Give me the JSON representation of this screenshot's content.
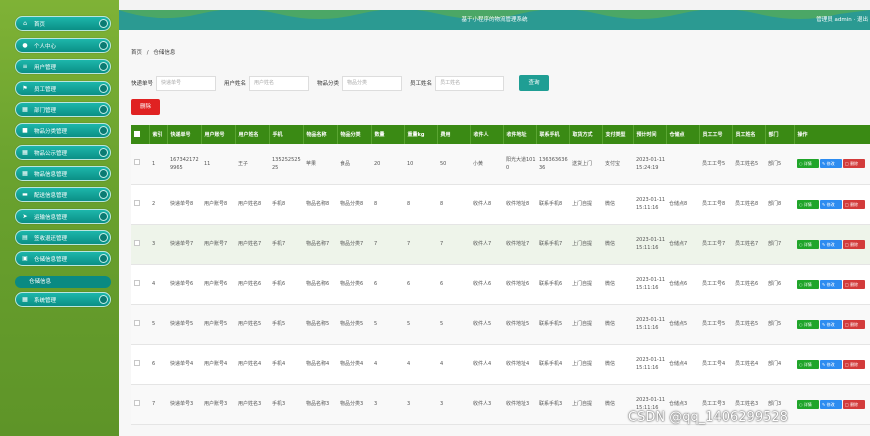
{
  "header": {
    "title": "基于小程序的物流管理系统",
    "user": "管理员 admin · 退出"
  },
  "sidebar": {
    "items": [
      {
        "label": "首页",
        "icon": "home-icon"
      },
      {
        "label": "个人中心",
        "icon": "user-icon"
      },
      {
        "label": "用户管理",
        "icon": "list-icon"
      },
      {
        "label": "员工管理",
        "icon": "flag-icon"
      },
      {
        "label": "部门管理",
        "icon": "grid-icon"
      },
      {
        "label": "物品分类管理",
        "icon": "box-icon"
      },
      {
        "label": "物品公示管理",
        "icon": "grid-icon"
      },
      {
        "label": "物品信息管理",
        "icon": "grid-icon"
      },
      {
        "label": "配送信息管理",
        "icon": "truck-icon"
      },
      {
        "label": "运输信息管理",
        "icon": "send-icon"
      },
      {
        "label": "签收退还管理",
        "icon": "doc-icon"
      },
      {
        "label": "仓储信息管理",
        "icon": "warehouse-icon"
      }
    ],
    "sub_item": "仓储信息",
    "last_item": {
      "label": "系统管理",
      "icon": "grid-icon"
    }
  },
  "breadcrumb": {
    "home": "首页",
    "sep": "/",
    "current": "仓储信息"
  },
  "search": {
    "fields": [
      {
        "label": "快递单号",
        "placeholder": "快递单号"
      },
      {
        "label": "用户姓名",
        "placeholder": "用户姓名"
      },
      {
        "label": "物品分类",
        "placeholder": "物品分类"
      },
      {
        "label": "员工姓名",
        "placeholder": "员工姓名"
      }
    ],
    "button": "查询"
  },
  "delete_button": "删除",
  "table": {
    "headers": [
      "",
      "索引",
      "快递单号",
      "用户账号",
      "用户姓名",
      "手机",
      "物品名称",
      "物品分类",
      "数量",
      "重量kg",
      "费用",
      "收件人",
      "收件地址",
      "联系手机",
      "取货方式",
      "支付类型",
      "预计时间",
      "仓储点",
      "员工工号",
      "员工姓名",
      "部门",
      "操作"
    ],
    "rows": [
      [
        "1",
        "1673421729965",
        "11",
        "王子",
        "13525252525",
        "苹果",
        "食品",
        "20",
        "10",
        "50",
        "小黄",
        "阳光大道1010",
        "13636363636",
        "送货上门",
        "支付宝",
        "2023-01-11 15:24:19",
        "",
        "员工工号5",
        "员工姓名5",
        "部门5"
      ],
      [
        "2",
        "快递单号8",
        "用户账号8",
        "用户姓名8",
        "手机8",
        "物品名称8",
        "物品分类8",
        "8",
        "8",
        "8",
        "收件人8",
        "收件地址8",
        "联系手机8",
        "上门自提",
        "微信",
        "2023-01-11 15:11:16",
        "仓储点8",
        "员工工号8",
        "员工姓名8",
        "部门8"
      ],
      [
        "3",
        "快递单号7",
        "用户账号7",
        "用户姓名7",
        "手机7",
        "物品名称7",
        "物品分类7",
        "7",
        "7",
        "7",
        "收件人7",
        "收件地址7",
        "联系手机7",
        "上门自提",
        "微信",
        "2023-01-11 15:11:16",
        "仓储点7",
        "员工工号7",
        "员工姓名7",
        "部门7"
      ],
      [
        "4",
        "快递单号6",
        "用户账号6",
        "用户姓名6",
        "手机6",
        "物品名称6",
        "物品分类6",
        "6",
        "6",
        "6",
        "收件人6",
        "收件地址6",
        "联系手机6",
        "上门自提",
        "微信",
        "2023-01-11 15:11:16",
        "仓储点6",
        "员工工号6",
        "员工姓名6",
        "部门6"
      ],
      [
        "5",
        "快递单号5",
        "用户账号5",
        "用户姓名5",
        "手机5",
        "物品名称5",
        "物品分类5",
        "5",
        "5",
        "5",
        "收件人5",
        "收件地址5",
        "联系手机5",
        "上门自提",
        "微信",
        "2023-01-11 15:11:16",
        "仓储点5",
        "员工工号5",
        "员工姓名5",
        "部门5"
      ],
      [
        "6",
        "快递单号4",
        "用户账号4",
        "用户姓名4",
        "手机4",
        "物品名称4",
        "物品分类4",
        "4",
        "4",
        "4",
        "收件人4",
        "收件地址4",
        "联系手机4",
        "上门自提",
        "微信",
        "2023-01-11 15:11:16",
        "仓储点4",
        "员工工号4",
        "员工姓名4",
        "部门4"
      ],
      [
        "7",
        "快递单号3",
        "用户账号3",
        "用户姓名3",
        "手机3",
        "物品名称3",
        "物品分类3",
        "3",
        "3",
        "3",
        "收件人3",
        "收件地址3",
        "联系手机3",
        "上门自提",
        "微信",
        "2023-01-11 15:11:16",
        "仓储点3",
        "员工工号3",
        "员工姓名3",
        "部门3"
      ]
    ],
    "row_actions": {
      "detail": "详情",
      "edit": "修改",
      "remove": "删除"
    }
  },
  "watermark": "CSDN @qq_1406299528",
  "colors": {
    "sidebar": "#6aa22e",
    "sidebar_item": "#0b8f86",
    "header": "#2b9a92",
    "table_header": "#3a8a14",
    "search_button": "#1f9e94",
    "delete_button": "#e02222",
    "detail": "#20a52a",
    "edit": "#2d8cf0",
    "remove": "#d33b3b"
  }
}
